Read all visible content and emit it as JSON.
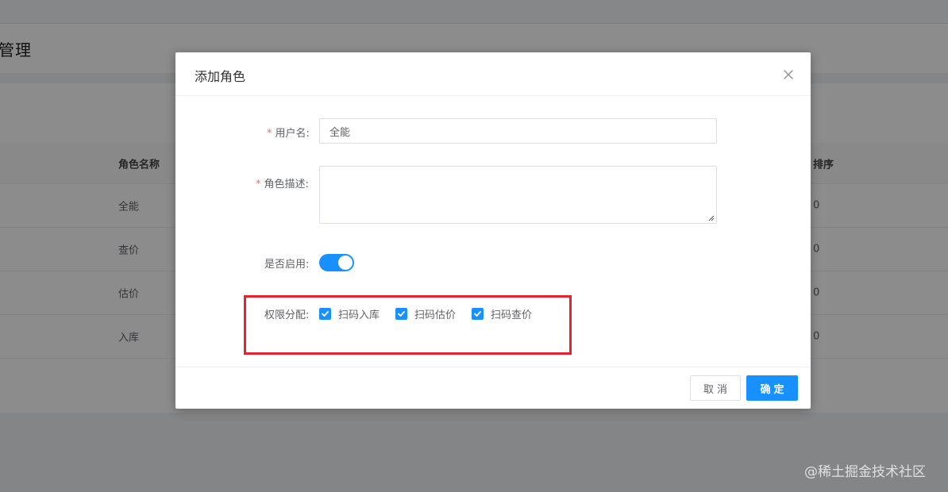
{
  "background": {
    "page_title": "管理",
    "table": {
      "headers": {
        "name": "角色名称",
        "order": "排序"
      },
      "rows": [
        {
          "name": "全能",
          "order": "0"
        },
        {
          "name": "查价",
          "order": "0"
        },
        {
          "name": "估价",
          "order": "0"
        },
        {
          "name": "入库",
          "order": "0"
        }
      ]
    }
  },
  "dialog": {
    "title": "添加角色",
    "close_icon": "close-icon",
    "fields": {
      "username": {
        "label": "用户名:",
        "required": "*",
        "value": "全能",
        "placeholder": ""
      },
      "description": {
        "label": "角色描述:",
        "required": "*",
        "value": ""
      },
      "enabled": {
        "label": "是否启用:",
        "value": "on"
      },
      "permissions": {
        "label": "权限分配:",
        "options": [
          {
            "label": "扫码入库",
            "checked": true
          },
          {
            "label": "扫码估价",
            "checked": true
          },
          {
            "label": "扫码查价",
            "checked": true
          }
        ]
      }
    },
    "buttons": {
      "cancel": "取消",
      "ok": "确定"
    }
  },
  "watermark": "@稀土掘金技术社区",
  "colors": {
    "primary": "#1890ff",
    "highlight_box": "#e8222c",
    "required": "#f56c6c"
  }
}
